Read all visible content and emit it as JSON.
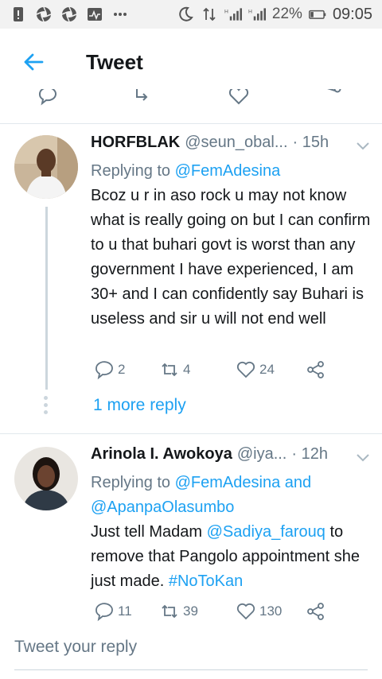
{
  "status_bar": {
    "battery": "22%",
    "time": "09:05",
    "signal_label_1": "H",
    "signal_label_2": "H"
  },
  "app_bar": {
    "title": "Tweet"
  },
  "replies": [
    {
      "name": "HORFBLAK",
      "handle": "@seun_obal...",
      "time": "· 15h",
      "replying_to_prefix": "Replying to",
      "replying_to": "@FemAdesina",
      "text": "Bcoz u r in aso rock u may not know what is really going on but I can confirm to u that buhari govt is worst than any government I have experienced, I am 30+ and I can confidently say Buhari is useless and sir u will not end well",
      "replies_count": "2",
      "retweets_count": "4",
      "likes_count": "24",
      "more_reply": "1 more reply"
    },
    {
      "name": "Arinola I. Awokoya",
      "handle": "@iya...",
      "time": "· 12h",
      "replying_to_prefix": "Replying to",
      "replying_to_1": "@FemAdesina and",
      "replying_to_2": "@ApanpaOlasumbo",
      "text_1": "Just tell Madam ",
      "mention": "@Sadiya_farouq",
      "text_2": " to remove that Pangolo appointment she just made. ",
      "hashtag": "#NoToKan",
      "replies_count": "11",
      "retweets_count": "39",
      "likes_count": "130"
    }
  ],
  "compose": {
    "placeholder": "Tweet your reply"
  },
  "colors": {
    "accent": "#1da1f2",
    "muted": "#657786",
    "text": "#14171a"
  }
}
